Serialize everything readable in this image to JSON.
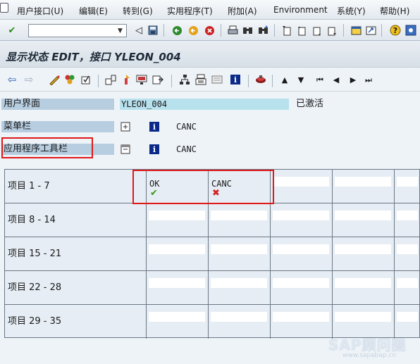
{
  "menu": [
    "用户接口(U)",
    "编辑(E)",
    "转到(G)",
    "实用程序(T)",
    "附加(A)",
    "Environment",
    "系统(Y)",
    "帮助(H)"
  ],
  "command_field": {
    "value": "",
    "placeholder": ""
  },
  "page_title": "显示状态 EDIT，接口 YLEON_004",
  "fields": {
    "user_interface": {
      "label": "用户界面",
      "value": "YLEON_004",
      "status": "已激活"
    },
    "menu_bar": {
      "label": "菜单栏",
      "code": "CANC"
    },
    "app_toolbar": {
      "label": "应用程序工具栏",
      "code": "CANC"
    }
  },
  "grid": {
    "rows": [
      "项目  1 -  7",
      "项目  8 - 14",
      "项目 15 - 21",
      "项目 22 - 28",
      "项目 29 - 35"
    ],
    "buttons": [
      {
        "code": "OK",
        "icon": "check-icon",
        "color": "#3a9a18"
      },
      {
        "code": "CANC",
        "icon": "cancel-icon",
        "color": "#d42020"
      }
    ]
  },
  "watermark": {
    "main": "SAP顾问圈",
    "sub": "www.sapabap.cn"
  },
  "colors": {
    "label_bg": "#b7cde0",
    "value_bg": "#b8e1ee",
    "highlight": "#e01818"
  }
}
